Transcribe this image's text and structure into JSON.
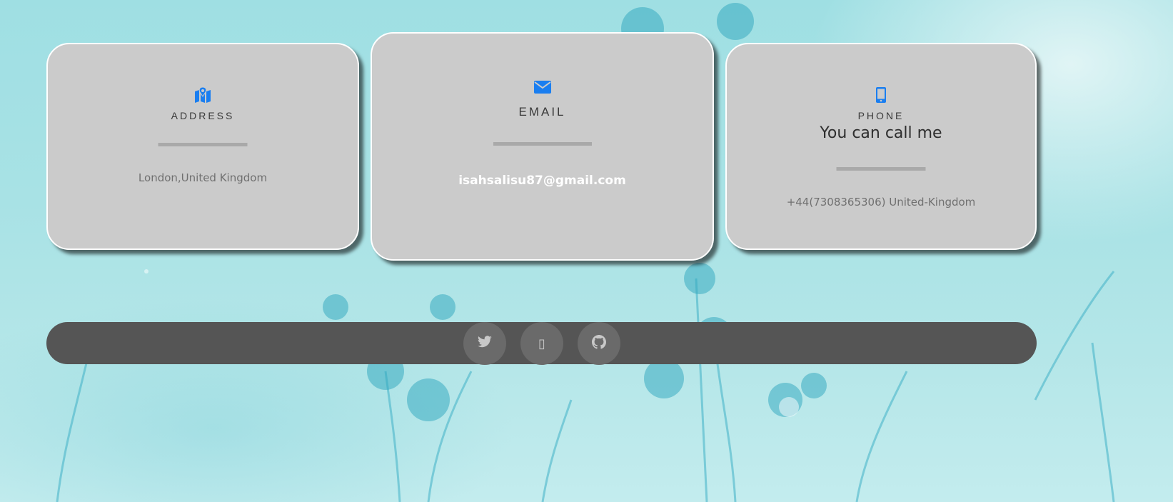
{
  "colors": {
    "accent": "#1a7ef0",
    "card_bg": "#cbcbcb",
    "footer_bg": "#555555"
  },
  "cards": {
    "address": {
      "icon": "map-marker-icon",
      "title": "ADDRESS",
      "value": "London,United Kingdom"
    },
    "email": {
      "icon": "envelope-icon",
      "title": "EMAIL",
      "value": "isahsalisu87@gmail.com"
    },
    "phone": {
      "icon": "mobile-phone-icon",
      "title": "PHONE",
      "subtitle": "You can call me",
      "value": "+44(7308365306) United-Kingdom"
    }
  },
  "footer": {
    "social": [
      {
        "icon": "twitter-icon"
      },
      {
        "icon": "unknown-glyph-icon",
        "glyph": "▯"
      },
      {
        "icon": "github-icon"
      }
    ]
  }
}
